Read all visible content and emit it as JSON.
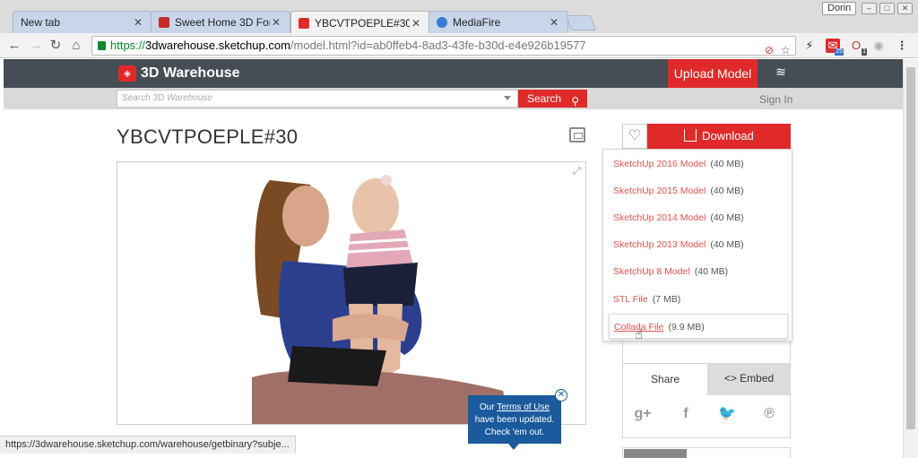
{
  "browser": {
    "tabs": [
      {
        "label": "New tab"
      },
      {
        "label": "Sweet Home 3D For"
      },
      {
        "label": "YBCVTPOEPLE#30 -"
      },
      {
        "label": "MediaFire"
      }
    ],
    "profile": "Dorin",
    "url_scheme": "https://",
    "url_host": "3dwarehouse.sketchup.com",
    "url_path": "/model.html?id=ab0ffeb4-8ad3-43fe-b30d-e4e926b19577",
    "ext_badge_1": "25",
    "ext_badge_2": "1",
    "status_url": "https://3dwarehouse.sketchup.com/warehouse/getbinary?subje..."
  },
  "site": {
    "logo_text": "3D Warehouse",
    "upload_label": "Upload Model",
    "search_placeholder": "Search 3D Warehouse",
    "search_label": "Search",
    "signin_label": "Sign In"
  },
  "model": {
    "title": "YBCVTPOEPLE#30"
  },
  "download": {
    "label": "Download",
    "options": [
      {
        "format": "SketchUp 2016 Model",
        "size": "(40 MB)"
      },
      {
        "format": "SketchUp 2015 Model",
        "size": "(40 MB)"
      },
      {
        "format": "SketchUp 2014 Model",
        "size": "(40 MB)"
      },
      {
        "format": "SketchUp 2013 Model",
        "size": "(40 MB)"
      },
      {
        "format": "SketchUp 8 Model",
        "size": "(40 MB)"
      },
      {
        "format": "STL File",
        "size": "(7 MB)"
      },
      {
        "format": "Collada File",
        "size": "(9.9 MB)"
      }
    ]
  },
  "share": {
    "share_tab": "Share",
    "embed_tab": "<> Embed"
  },
  "terms_popup": {
    "line1_pre": "Our ",
    "line1_link": "Terms of Use",
    "line2": "have been updated.",
    "line3": "Check 'em out."
  },
  "colors": {
    "brand_red": "#e02a2a",
    "nav_dark": "#474d54",
    "popup_blue": "#1b5a9c"
  }
}
